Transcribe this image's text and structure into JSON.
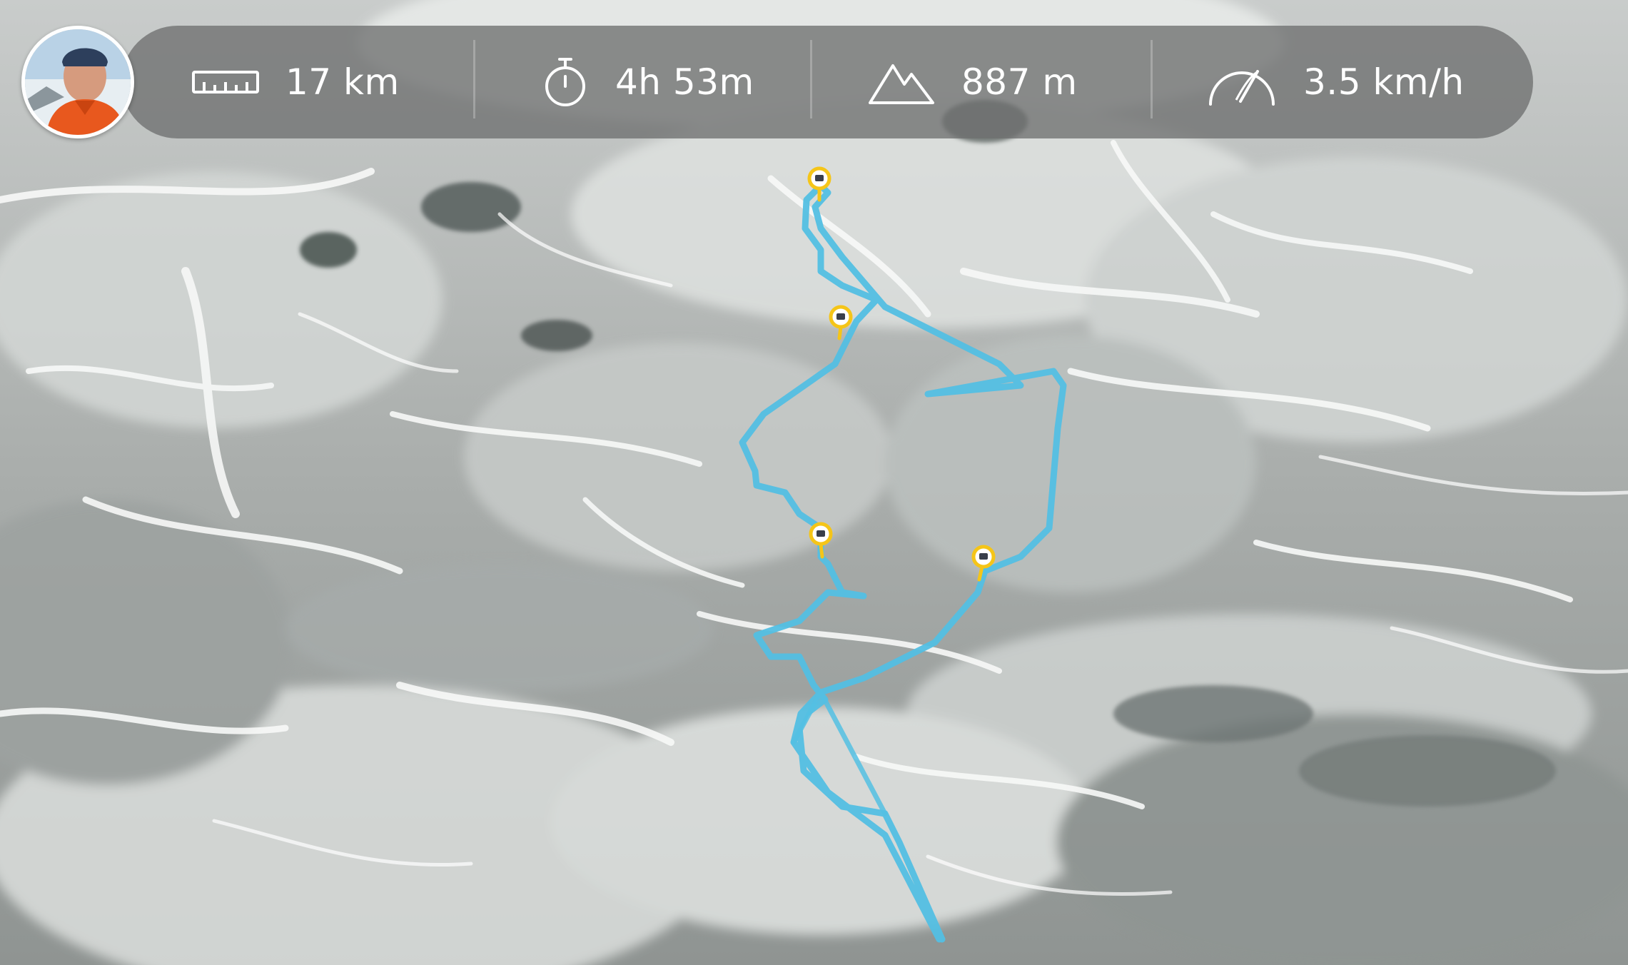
{
  "stats": {
    "distance": "17 km",
    "duration": "4h 53m",
    "elevation": "887 m",
    "speed": "3.5 km/h"
  },
  "icons": {
    "distance": "ruler-icon",
    "duration": "stopwatch-icon",
    "elevation": "mountain-icon",
    "speed": "speedometer-icon",
    "waypoint": "map-pin-icon"
  },
  "colors": {
    "route": "#53bfe3",
    "waypoint": "#f5c518",
    "bar": "#6e7070",
    "text": "#ffffff"
  }
}
